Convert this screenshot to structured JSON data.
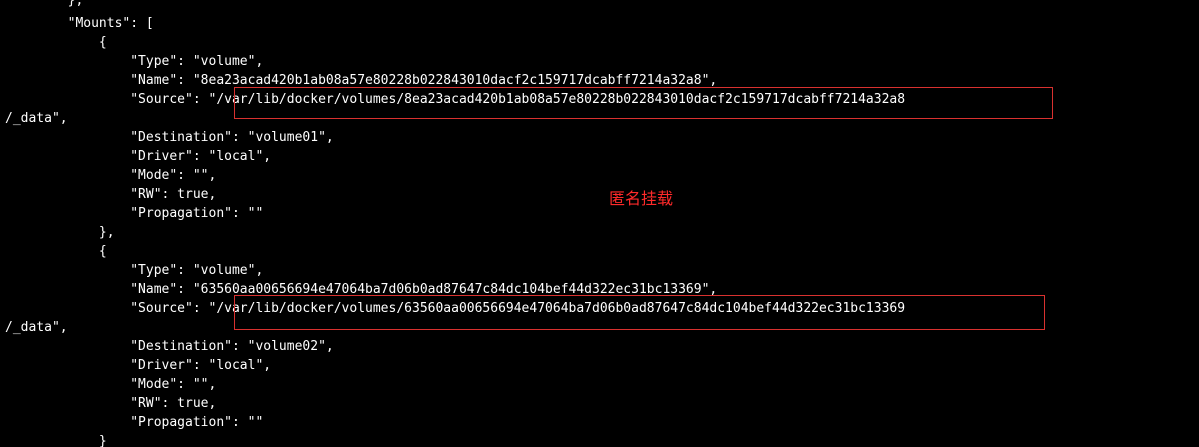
{
  "terminal": {
    "lines": [
      "        },",
      "        \"Mounts\": [",
      "            {",
      "                \"Type\": \"volume\",",
      "                \"Name\": \"8ea23acad420b1ab08a57e80228b022843010dacf2c159717dcabff7214a32a8\",",
      "                \"Source\": \"/var/lib/docker/volumes/8ea23acad420b1ab08a57e80228b022843010dacf2c159717dcabff7214a32a8",
      "/_data\",",
      "                \"Destination\": \"volume01\",",
      "                \"Driver\": \"local\",",
      "                \"Mode\": \"\",",
      "                \"RW\": true,",
      "                \"Propagation\": \"\"",
      "            },",
      "            {",
      "                \"Type\": \"volume\",",
      "                \"Name\": \"63560aa00656694e47064ba7d06b0ad87647c84dc104bef44d322ec31bc13369\",",
      "                \"Source\": \"/var/lib/docker/volumes/63560aa00656694e47064ba7d06b0ad87647c84dc104bef44d322ec31bc13369",
      "/_data\",",
      "                \"Destination\": \"volume02\",",
      "                \"Driver\": \"local\",",
      "                \"Mode\": \"\",",
      "                \"RW\": true,",
      "                \"Propagation\": \"\"",
      "            }"
    ],
    "text_color": "#ffffff",
    "background_color": "#000000"
  },
  "annotation": {
    "label": "匿名挂载",
    "color": "#ff2a2a"
  },
  "highlight_color": "#d9312f"
}
